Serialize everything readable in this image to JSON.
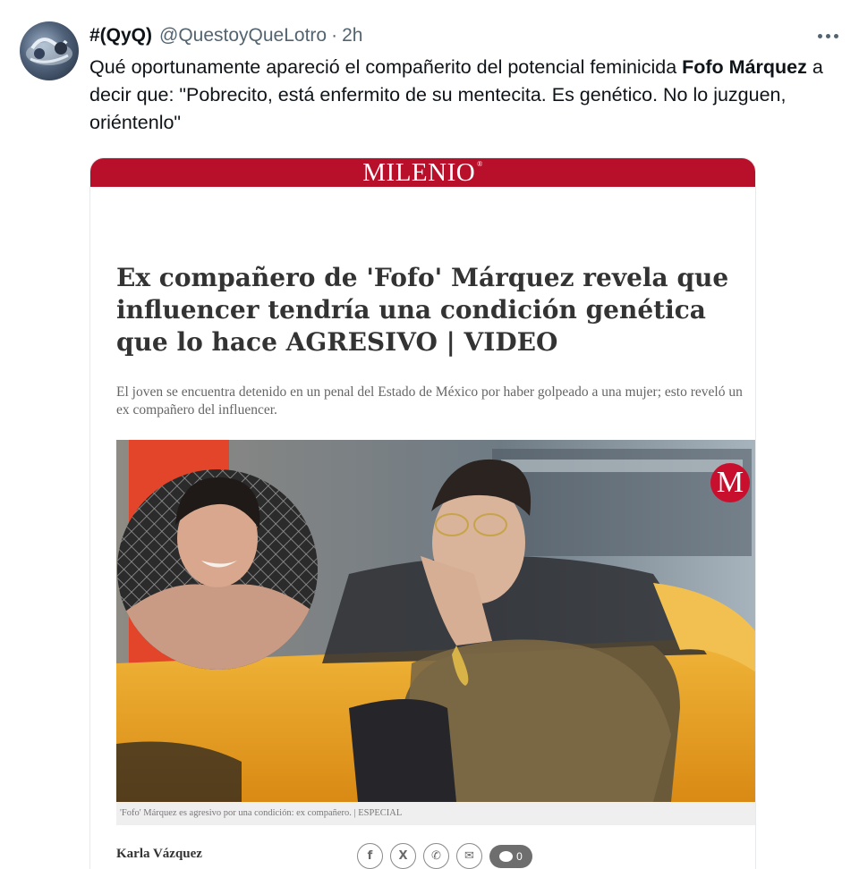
{
  "tweet": {
    "display_name": "#(QyQ)",
    "handle": "@QuestoyQueLotro",
    "separator": "·",
    "time": "2h",
    "text_part1": "Qué oportunamente apareció el compañerito del potencial feminicida ",
    "text_bold": "Fofo Márquez",
    "text_part2": " a decir que: \"Pobrecito, está enfermito de su mentecita. Es genético. No lo juzguen, oriéntenlo\"",
    "more_icon": "more-horizontal-icon"
  },
  "article": {
    "brand": "MILENIO",
    "brand_mark": "®",
    "headline": "Ex compañero de 'Fofo' Márquez revela que influencer tendría una condición genética que lo hace AGRESIVO | VIDEO",
    "deck": "El joven se encuentra detenido en un penal del Estado de México por haber golpeado a una mujer; esto reveló un ex compañero del influencer.",
    "photo_logo": "M",
    "caption": "'Fofo' Márquez es agresivo por una condición: ex compañero. | ESPECIAL",
    "author": "Karla Vázquez",
    "share": {
      "facebook": "f",
      "x": "X",
      "whatsapp": "✆",
      "email": "✉",
      "comments_count": "0"
    },
    "colors": {
      "brand_red": "#b8102b",
      "logo_red": "#c8102e"
    }
  }
}
